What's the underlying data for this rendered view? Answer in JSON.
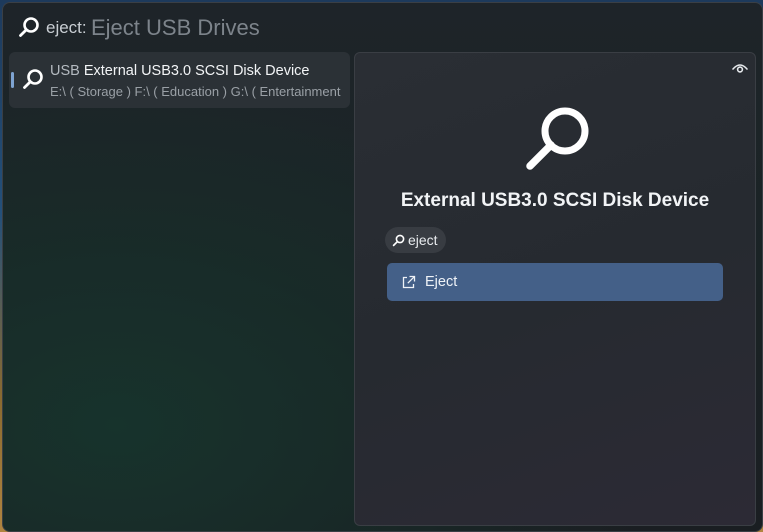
{
  "search": {
    "prefix": "eject:",
    "hint": "Eject USB Drives"
  },
  "results": [
    {
      "tag": "USB",
      "title": "External USB3.0 SCSI Disk Device",
      "subtitle": "E:\\ ( Storage ) F:\\ ( Education ) G:\\ ( Entertainment )",
      "icon": "search-icon"
    }
  ],
  "preview": {
    "title": "External USB3.0 SCSI Disk Device",
    "keyword": "eject",
    "action_label": "Eject",
    "icons": [
      "eye-icon",
      "search-icon",
      "open-external-icon"
    ]
  },
  "colors": {
    "accent": "#7ea3d1",
    "action_button": "#446088"
  }
}
